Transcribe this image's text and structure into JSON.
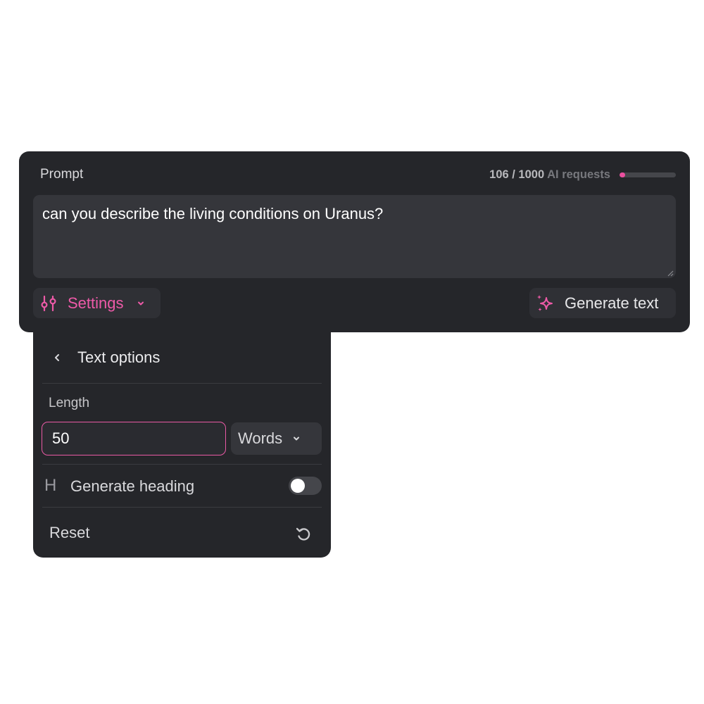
{
  "prompt": {
    "label": "Prompt",
    "value": "can you describe the living conditions on Uranus?"
  },
  "usage": {
    "count": "106 / 1000",
    "unit_label": "AI requests",
    "fraction": 0.106,
    "accent_color": "#ea4f9f"
  },
  "toolbar": {
    "settings_label": "Settings",
    "settings_icon": "sliders-icon",
    "generate_label": "Generate text",
    "generate_icon": "sparkle-icon"
  },
  "text_options": {
    "title": "Text options",
    "length_label": "Length",
    "length_value": "50",
    "unit_selected": "Words",
    "heading_label": "Generate heading",
    "heading_enabled": false,
    "reset_label": "Reset"
  }
}
